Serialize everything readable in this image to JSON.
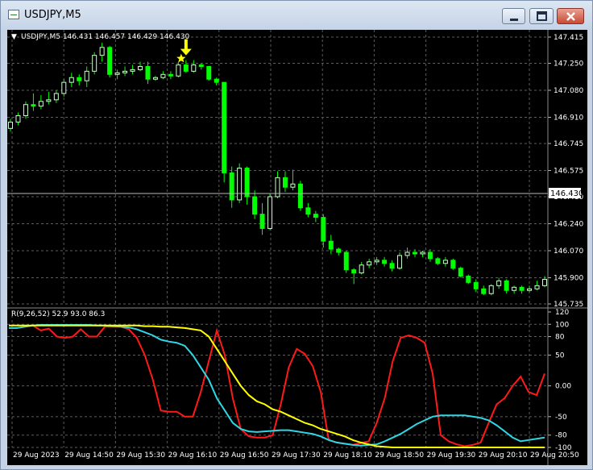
{
  "window": {
    "title": "USDJPY,M5",
    "controls": {
      "minimize": "minimize",
      "maximize": "maximize",
      "close": "close"
    }
  },
  "colors": {
    "background": "#000000",
    "bull_candle": "#ccffcc",
    "bear_candle": "#00ff00",
    "grid": "#5c5c5c",
    "rsi9": "#ff1a1a",
    "rsi26": "#2fd7e6",
    "rsi52": "#ffff00",
    "arrow": "#ffff00"
  },
  "chart_data": [
    {
      "type": "candlestick",
      "title": "USDJPY,M5",
      "header": "USDJPY,M5  146.431 146.457 146.429 146.430",
      "ohlc_header": {
        "open": 146.431,
        "high": 146.457,
        "low": 146.429,
        "close": 146.43
      },
      "current_price": "146.430",
      "y_ticks": [
        "147.415",
        "147.250",
        "147.080",
        "146.910",
        "146.745",
        "146.575",
        "146.410",
        "146.240",
        "146.070",
        "145.900",
        "145.735"
      ],
      "ylim": [
        145.735,
        147.415
      ],
      "x_ticks": [
        "29 Aug 2023",
        "29 Aug 14:50",
        "29 Aug 15:30",
        "29 Aug 16:10",
        "29 Aug 16:50",
        "29 Aug 17:30",
        "29 Aug 18:10",
        "29 Aug 18:50",
        "29 Aug 19:30",
        "29 Aug 20:10",
        "29 Aug 20:50"
      ],
      "grid": true,
      "candles": [
        [
          146.84,
          146.9,
          146.82,
          146.88
        ],
        [
          146.88,
          146.94,
          146.86,
          146.92
        ],
        [
          146.92,
          147.01,
          146.9,
          146.99
        ],
        [
          146.99,
          147.06,
          146.95,
          146.98
        ],
        [
          146.98,
          147.05,
          146.96,
          147.01
        ],
        [
          147.01,
          147.07,
          146.99,
          147.02
        ],
        [
          147.02,
          147.08,
          147.0,
          147.06
        ],
        [
          147.06,
          147.15,
          147.04,
          147.13
        ],
        [
          147.13,
          147.19,
          147.1,
          147.16
        ],
        [
          147.16,
          147.18,
          147.11,
          147.14
        ],
        [
          147.14,
          147.23,
          147.1,
          147.2
        ],
        [
          147.2,
          147.32,
          147.18,
          147.3
        ],
        [
          147.3,
          147.38,
          147.26,
          147.35
        ],
        [
          147.35,
          147.36,
          147.16,
          147.18
        ],
        [
          147.18,
          147.21,
          147.15,
          147.19
        ],
        [
          147.19,
          147.23,
          147.17,
          147.2
        ],
        [
          147.2,
          147.24,
          147.18,
          147.21
        ],
        [
          147.21,
          147.26,
          147.2,
          147.23
        ],
        [
          147.23,
          147.26,
          147.12,
          147.15
        ],
        [
          147.15,
          147.17,
          147.14,
          147.16
        ],
        [
          147.16,
          147.2,
          147.15,
          147.18
        ],
        [
          147.18,
          147.2,
          147.15,
          147.17
        ],
        [
          147.17,
          147.26,
          147.16,
          147.24
        ],
        [
          147.24,
          147.27,
          147.19,
          147.2
        ],
        [
          147.2,
          147.27,
          147.19,
          147.24
        ],
        [
          147.24,
          147.25,
          147.21,
          147.23
        ],
        [
          147.23,
          147.23,
          147.14,
          147.15
        ],
        [
          147.15,
          147.16,
          147.11,
          147.13
        ],
        [
          147.13,
          147.13,
          146.5,
          146.56
        ],
        [
          146.56,
          146.6,
          146.34,
          146.39
        ],
        [
          146.39,
          146.62,
          146.37,
          146.59
        ],
        [
          146.59,
          146.6,
          146.36,
          146.41
        ],
        [
          146.41,
          146.45,
          146.27,
          146.3
        ],
        [
          146.3,
          146.37,
          146.17,
          146.21
        ],
        [
          146.21,
          146.43,
          146.2,
          146.41
        ],
        [
          146.41,
          146.57,
          146.4,
          146.53
        ],
        [
          146.53,
          146.57,
          146.44,
          146.47
        ],
        [
          146.47,
          146.58,
          146.45,
          146.49
        ],
        [
          146.49,
          146.51,
          146.32,
          146.34
        ],
        [
          146.34,
          146.37,
          146.28,
          146.3
        ],
        [
          146.3,
          146.32,
          146.25,
          146.28
        ],
        [
          146.28,
          146.3,
          146.09,
          146.13
        ],
        [
          146.13,
          146.17,
          146.05,
          146.08
        ],
        [
          146.08,
          146.09,
          146.04,
          146.06
        ],
        [
          146.06,
          146.07,
          145.93,
          145.95
        ],
        [
          145.95,
          145.96,
          145.86,
          145.93
        ],
        [
          145.93,
          146.0,
          145.92,
          145.98
        ],
        [
          145.98,
          146.02,
          145.96,
          146.0
        ],
        [
          146.0,
          146.03,
          145.98,
          146.01
        ],
        [
          146.01,
          146.03,
          145.97,
          145.99
        ],
        [
          145.99,
          146.01,
          145.94,
          145.96
        ],
        [
          145.96,
          146.06,
          145.95,
          146.04
        ],
        [
          146.04,
          146.09,
          146.02,
          146.06
        ],
        [
          146.06,
          146.08,
          146.03,
          146.05
        ],
        [
          146.05,
          146.07,
          146.03,
          146.06
        ],
        [
          146.06,
          146.08,
          146.0,
          146.02
        ],
        [
          146.02,
          146.03,
          145.98,
          145.99
        ],
        [
          145.99,
          146.03,
          145.97,
          146.01
        ],
        [
          146.01,
          146.02,
          145.95,
          145.96
        ],
        [
          145.96,
          145.97,
          145.9,
          145.91
        ],
        [
          145.91,
          145.92,
          145.86,
          145.87
        ],
        [
          145.87,
          145.89,
          145.81,
          145.83
        ],
        [
          145.83,
          145.85,
          145.79,
          145.8
        ],
        [
          145.8,
          145.86,
          145.79,
          145.85
        ],
        [
          145.85,
          145.9,
          145.83,
          145.88
        ],
        [
          145.88,
          145.89,
          145.8,
          145.82
        ],
        [
          145.82,
          145.85,
          145.8,
          145.84
        ],
        [
          145.84,
          145.85,
          145.8,
          145.82
        ],
        [
          145.82,
          145.85,
          145.81,
          145.83
        ],
        [
          145.83,
          145.88,
          145.82,
          145.85
        ],
        [
          145.85,
          145.91,
          145.84,
          145.89
        ]
      ],
      "marker": {
        "candle_index": 23,
        "symbols": [
          "arrow-down",
          "star"
        ]
      }
    },
    {
      "type": "line",
      "title": "R(9,26,52) 52.9 93.0 86.3",
      "y_ticks": [
        "120",
        "100",
        "80",
        "50",
        "0.00",
        "-50",
        "-80",
        "-100"
      ],
      "ylim": [
        -100,
        120
      ],
      "levels": [
        100,
        80,
        50,
        0,
        -50,
        -80,
        -100
      ],
      "series": [
        {
          "name": "9",
          "values": [
            94,
            94,
            96,
            98,
            90,
            93,
            80,
            78,
            80,
            92,
            80,
            80,
            96,
            96,
            96,
            92,
            78,
            50,
            10,
            -40,
            -42,
            -42,
            -50,
            -50,
            -10,
            40,
            90,
            50,
            -20,
            -70,
            -82,
            -84,
            -84,
            -80,
            -30,
            30,
            60,
            52,
            32,
            -10,
            -88,
            -92,
            -94,
            -96,
            -93,
            -90,
            -60,
            -20,
            40,
            78,
            82,
            78,
            70,
            20,
            -80,
            -90,
            -95,
            -98,
            -96,
            -92,
            -60,
            -30,
            -20,
            0,
            15,
            -10,
            -15,
            20
          ]
        },
        {
          "name": "26",
          "values": [
            94,
            94,
            96,
            98,
            99,
            99,
            99,
            99,
            99,
            99,
            99,
            98,
            98,
            97,
            96,
            95,
            92,
            87,
            82,
            75,
            72,
            70,
            65,
            50,
            30,
            10,
            -20,
            -40,
            -60,
            -70,
            -74,
            -75,
            -74,
            -73,
            -72,
            -72,
            -74,
            -76,
            -78,
            -82,
            -88,
            -92,
            -94,
            -96,
            -97,
            -96,
            -95,
            -90,
            -84,
            -78,
            -70,
            -62,
            -56,
            -50,
            -48,
            -48,
            -48,
            -48,
            -50,
            -52,
            -56,
            -64,
            -74,
            -84,
            -90,
            -88,
            -86,
            -84
          ]
        },
        {
          "name": "52",
          "values": [
            98,
            98,
            98,
            98,
            98,
            98,
            98,
            98,
            98,
            98,
            98,
            98,
            98,
            98,
            98,
            98,
            98,
            97,
            97,
            96,
            96,
            95,
            94,
            92,
            90,
            80,
            60,
            40,
            20,
            0,
            -15,
            -25,
            -30,
            -38,
            -42,
            -48,
            -54,
            -60,
            -64,
            -70,
            -74,
            -78,
            -82,
            -88,
            -92,
            -95,
            -98,
            -99,
            -100,
            -100,
            -100,
            -100,
            -100,
            -100,
            -100,
            -100,
            -100,
            -100,
            -100,
            -100,
            -100,
            -100,
            -100,
            -100,
            -100,
            -100,
            -100,
            -100
          ]
        }
      ],
      "x_ticks": [
        "29 Aug 2023",
        "29 Aug 14:50",
        "29 Aug 15:30",
        "29 Aug 16:10",
        "29 Aug 16:50",
        "29 Aug 17:30",
        "29 Aug 18:10",
        "29 Aug 18:50",
        "29 Aug 19:30",
        "29 Aug 20:10",
        "29 Aug 20:50"
      ]
    }
  ]
}
